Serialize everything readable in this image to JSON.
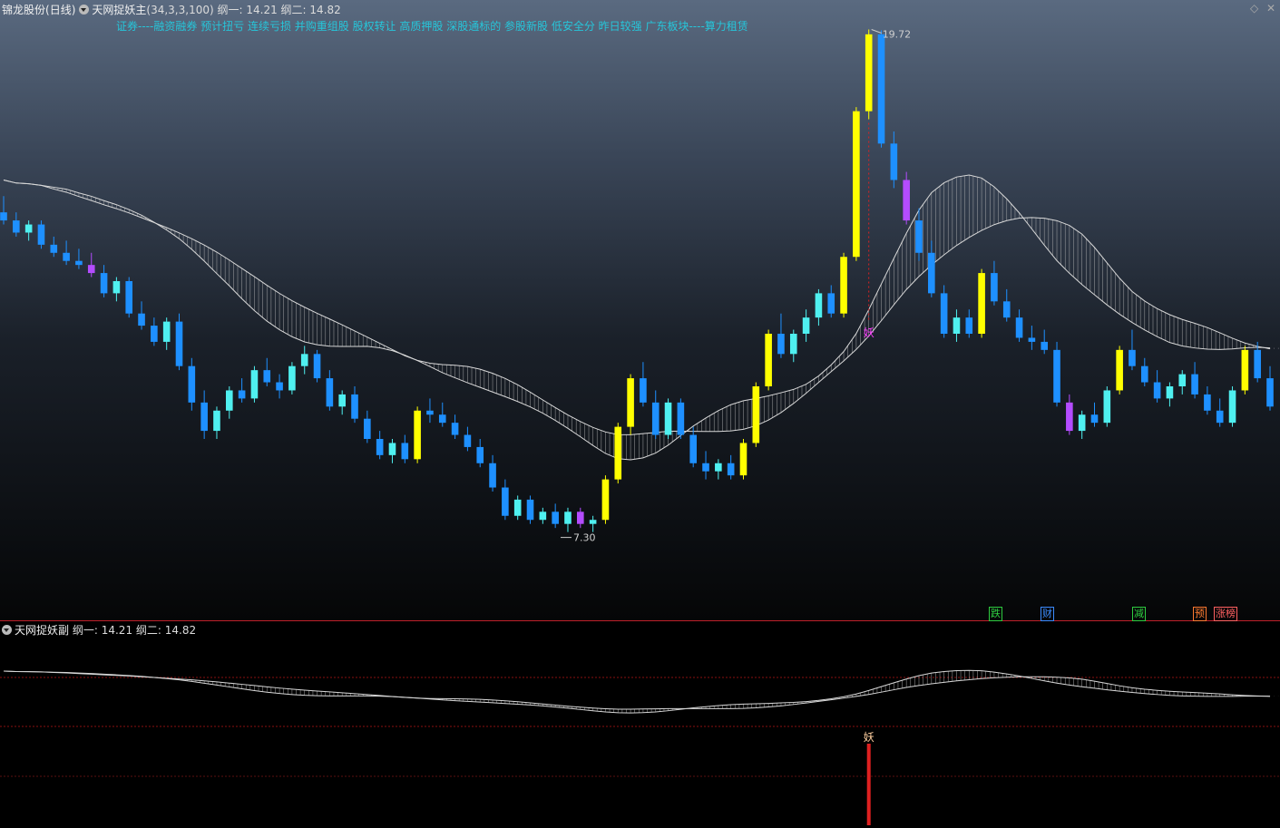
{
  "header": {
    "stock_name": "锦龙股份",
    "period": "(日线)",
    "indicator_name": "天网捉妖主",
    "params": "(34,3,3,100)",
    "line1_label": "纲一:",
    "line1_value": "14.21",
    "line2_label": "纲二:",
    "line2_value": "14.82"
  },
  "concepts": "证券----融资融券 预计扭亏 连续亏损 并购重组股 股权转让 高质押股 深股通标的 参股新股 低安全分 昨日较强 广东板块----算力租赁",
  "controls": {
    "diamond": "◇",
    "close": "✕"
  },
  "sub_header": {
    "indicator_name": "天网捉妖副",
    "line1_label": "纲一:",
    "line1_value": "14.21",
    "line2_label": "纲二:",
    "line2_value": "14.82"
  },
  "annotations": {
    "high": "19.72",
    "low": "7.30",
    "yao_main": "妖",
    "yao_sub": "妖"
  },
  "event_tags": [
    {
      "label": "跌",
      "color": "#2ecc40"
    },
    {
      "label": "财",
      "color": "#3b8bff"
    },
    {
      "label": "减",
      "color": "#2ecc40"
    },
    {
      "label": "预",
      "color": "#ff7a30"
    },
    {
      "label": "涨榜",
      "color": "#ff6060"
    }
  ],
  "colors": {
    "candle_down": "#1e90ff",
    "candle_up_cyan": "#4ff0f0",
    "limit_up": "#ffff00",
    "red": "#e02020",
    "purple": "#b44cff",
    "blue": "#1a3cff",
    "orange": "#ff9f1a",
    "band": "#bcbcbc",
    "yao": "#ff40ff"
  },
  "chart_data": {
    "type": "candlestick",
    "y_range": [
      7.0,
      20.0
    ],
    "high_marker": 19.72,
    "low_marker": 7.3,
    "ohlc": [
      [
        15.2,
        15.6,
        14.9,
        15.0
      ],
      [
        15.0,
        15.2,
        14.6,
        14.7
      ],
      [
        14.7,
        15.0,
        14.5,
        14.9
      ],
      [
        14.9,
        15.0,
        14.3,
        14.4
      ],
      [
        14.4,
        14.6,
        14.1,
        14.2
      ],
      [
        14.2,
        14.5,
        13.9,
        14.0
      ],
      [
        14.0,
        14.3,
        13.8,
        13.9
      ],
      [
        13.9,
        14.2,
        13.6,
        13.7
      ],
      [
        13.7,
        13.9,
        13.1,
        13.2
      ],
      [
        13.2,
        13.6,
        13.0,
        13.5
      ],
      [
        13.5,
        13.6,
        12.6,
        12.7
      ],
      [
        12.7,
        13.0,
        12.3,
        12.4
      ],
      [
        12.4,
        12.6,
        11.9,
        12.0
      ],
      [
        12.0,
        12.6,
        11.8,
        12.5
      ],
      [
        12.5,
        12.7,
        11.3,
        11.4
      ],
      [
        11.4,
        11.6,
        10.3,
        10.5
      ],
      [
        10.5,
        10.8,
        9.6,
        9.8
      ],
      [
        9.8,
        10.4,
        9.6,
        10.3
      ],
      [
        10.3,
        10.9,
        10.1,
        10.8
      ],
      [
        10.8,
        11.1,
        10.5,
        10.6
      ],
      [
        10.6,
        11.4,
        10.5,
        11.3
      ],
      [
        11.3,
        11.6,
        10.9,
        11.0
      ],
      [
        11.0,
        11.2,
        10.6,
        10.8
      ],
      [
        10.8,
        11.5,
        10.7,
        11.4
      ],
      [
        11.4,
        11.9,
        11.2,
        11.7
      ],
      [
        11.7,
        11.8,
        11.0,
        11.1
      ],
      [
        11.1,
        11.3,
        10.3,
        10.4
      ],
      [
        10.4,
        10.8,
        10.2,
        10.7
      ],
      [
        10.7,
        10.9,
        10.0,
        10.1
      ],
      [
        10.1,
        10.3,
        9.5,
        9.6
      ],
      [
        9.6,
        9.8,
        9.1,
        9.2
      ],
      [
        9.2,
        9.6,
        9.0,
        9.5
      ],
      [
        9.5,
        9.7,
        9.0,
        9.1
      ],
      [
        9.1,
        10.4,
        9.0,
        10.3
      ],
      [
        10.3,
        10.6,
        10.0,
        10.2
      ],
      [
        10.2,
        10.5,
        9.9,
        10.0
      ],
      [
        10.0,
        10.2,
        9.6,
        9.7
      ],
      [
        9.7,
        9.9,
        9.3,
        9.4
      ],
      [
        9.4,
        9.6,
        8.9,
        9.0
      ],
      [
        9.0,
        9.2,
        8.3,
        8.4
      ],
      [
        8.4,
        8.6,
        7.6,
        7.7
      ],
      [
        7.7,
        8.2,
        7.6,
        8.1
      ],
      [
        8.1,
        8.2,
        7.5,
        7.6
      ],
      [
        7.6,
        7.9,
        7.5,
        7.8
      ],
      [
        7.8,
        8.0,
        7.4,
        7.5
      ],
      [
        7.5,
        7.9,
        7.3,
        7.8
      ],
      [
        7.8,
        7.9,
        7.4,
        7.5
      ],
      [
        7.5,
        7.7,
        7.3,
        7.6
      ],
      [
        7.6,
        8.7,
        7.5,
        8.6
      ],
      [
        8.6,
        10.0,
        8.5,
        9.9
      ],
      [
        9.9,
        11.2,
        9.7,
        11.1
      ],
      [
        11.1,
        11.5,
        10.4,
        10.5
      ],
      [
        10.5,
        10.8,
        9.6,
        9.7
      ],
      [
        9.7,
        10.6,
        9.6,
        10.5
      ],
      [
        10.5,
        10.6,
        9.6,
        9.7
      ],
      [
        9.7,
        9.9,
        8.9,
        9.0
      ],
      [
        9.0,
        9.3,
        8.6,
        8.8
      ],
      [
        8.8,
        9.1,
        8.6,
        9.0
      ],
      [
        9.0,
        9.2,
        8.6,
        8.7
      ],
      [
        8.7,
        9.6,
        8.6,
        9.5
      ],
      [
        9.5,
        11.0,
        9.4,
        10.9
      ],
      [
        10.9,
        12.3,
        10.8,
        12.2
      ],
      [
        12.2,
        12.7,
        11.6,
        11.7
      ],
      [
        11.7,
        12.3,
        11.5,
        12.2
      ],
      [
        12.2,
        12.8,
        12.0,
        12.6
      ],
      [
        12.6,
        13.3,
        12.4,
        13.2
      ],
      [
        13.2,
        13.4,
        12.6,
        12.7
      ],
      [
        12.7,
        14.2,
        12.6,
        14.1
      ],
      [
        14.1,
        17.8,
        14.0,
        17.7
      ],
      [
        17.7,
        19.72,
        17.5,
        19.6
      ],
      [
        19.6,
        19.7,
        16.8,
        16.9
      ],
      [
        16.9,
        17.2,
        15.8,
        16.0
      ],
      [
        16.0,
        16.2,
        14.9,
        15.0
      ],
      [
        15.0,
        15.3,
        14.0,
        14.2
      ],
      [
        14.2,
        14.5,
        13.1,
        13.2
      ],
      [
        13.2,
        13.4,
        12.1,
        12.2
      ],
      [
        12.2,
        12.8,
        12.0,
        12.6
      ],
      [
        12.6,
        12.8,
        12.1,
        12.2
      ],
      [
        12.2,
        13.8,
        12.1,
        13.7
      ],
      [
        13.7,
        14.0,
        12.9,
        13.0
      ],
      [
        13.0,
        13.3,
        12.5,
        12.6
      ],
      [
        12.6,
        12.8,
        12.0,
        12.1
      ],
      [
        12.1,
        12.4,
        11.8,
        12.0
      ],
      [
        12.0,
        12.3,
        11.7,
        11.8
      ],
      [
        11.8,
        12.0,
        10.4,
        10.5
      ],
      [
        10.5,
        10.7,
        9.7,
        9.8
      ],
      [
        9.8,
        10.3,
        9.6,
        10.2
      ],
      [
        10.2,
        10.5,
        9.9,
        10.0
      ],
      [
        10.0,
        10.9,
        9.9,
        10.8
      ],
      [
        10.8,
        11.9,
        10.7,
        11.8
      ],
      [
        11.8,
        12.3,
        11.3,
        11.4
      ],
      [
        11.4,
        11.6,
        10.9,
        11.0
      ],
      [
        11.0,
        11.3,
        10.5,
        10.6
      ],
      [
        10.6,
        11.0,
        10.4,
        10.9
      ],
      [
        10.9,
        11.3,
        10.7,
        11.2
      ],
      [
        11.2,
        11.5,
        10.6,
        10.7
      ],
      [
        10.7,
        10.9,
        10.2,
        10.3
      ],
      [
        10.3,
        10.6,
        9.9,
        10.0
      ],
      [
        10.0,
        10.9,
        9.9,
        10.8
      ],
      [
        10.8,
        11.9,
        10.7,
        11.8
      ],
      [
        11.8,
        12.0,
        11.0,
        11.1
      ],
      [
        11.1,
        11.4,
        10.3,
        10.4
      ]
    ]
  }
}
